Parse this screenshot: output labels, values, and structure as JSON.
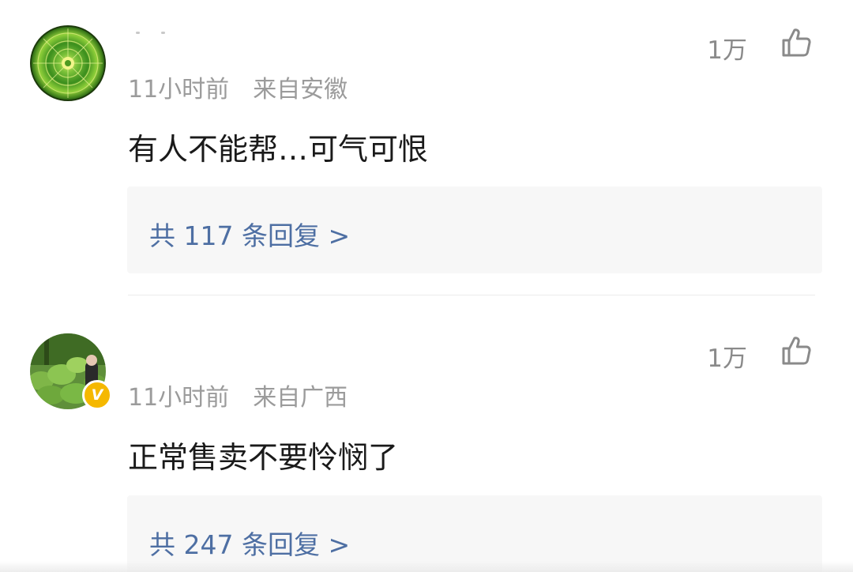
{
  "comments": [
    {
      "likes": "1万",
      "time": "11小时前",
      "location": "来自安徽",
      "text": "有人不能帮…可气可恨",
      "replies_link": "共 117 条回复 >",
      "verified": false
    },
    {
      "likes": "1万",
      "time": "11小时前",
      "location": "来自广西",
      "text": "正常售卖不要怜悯了",
      "replies_link": "共 247 条回复 >",
      "verified": true,
      "badge": "V"
    }
  ],
  "icons": {
    "like": "thumbs-up-outline-icon"
  },
  "colors": {
    "link": "#4e6fa3",
    "meta": "#9b9b9b",
    "badge": "#f5b800",
    "reply_bg": "#f7f7f7"
  }
}
